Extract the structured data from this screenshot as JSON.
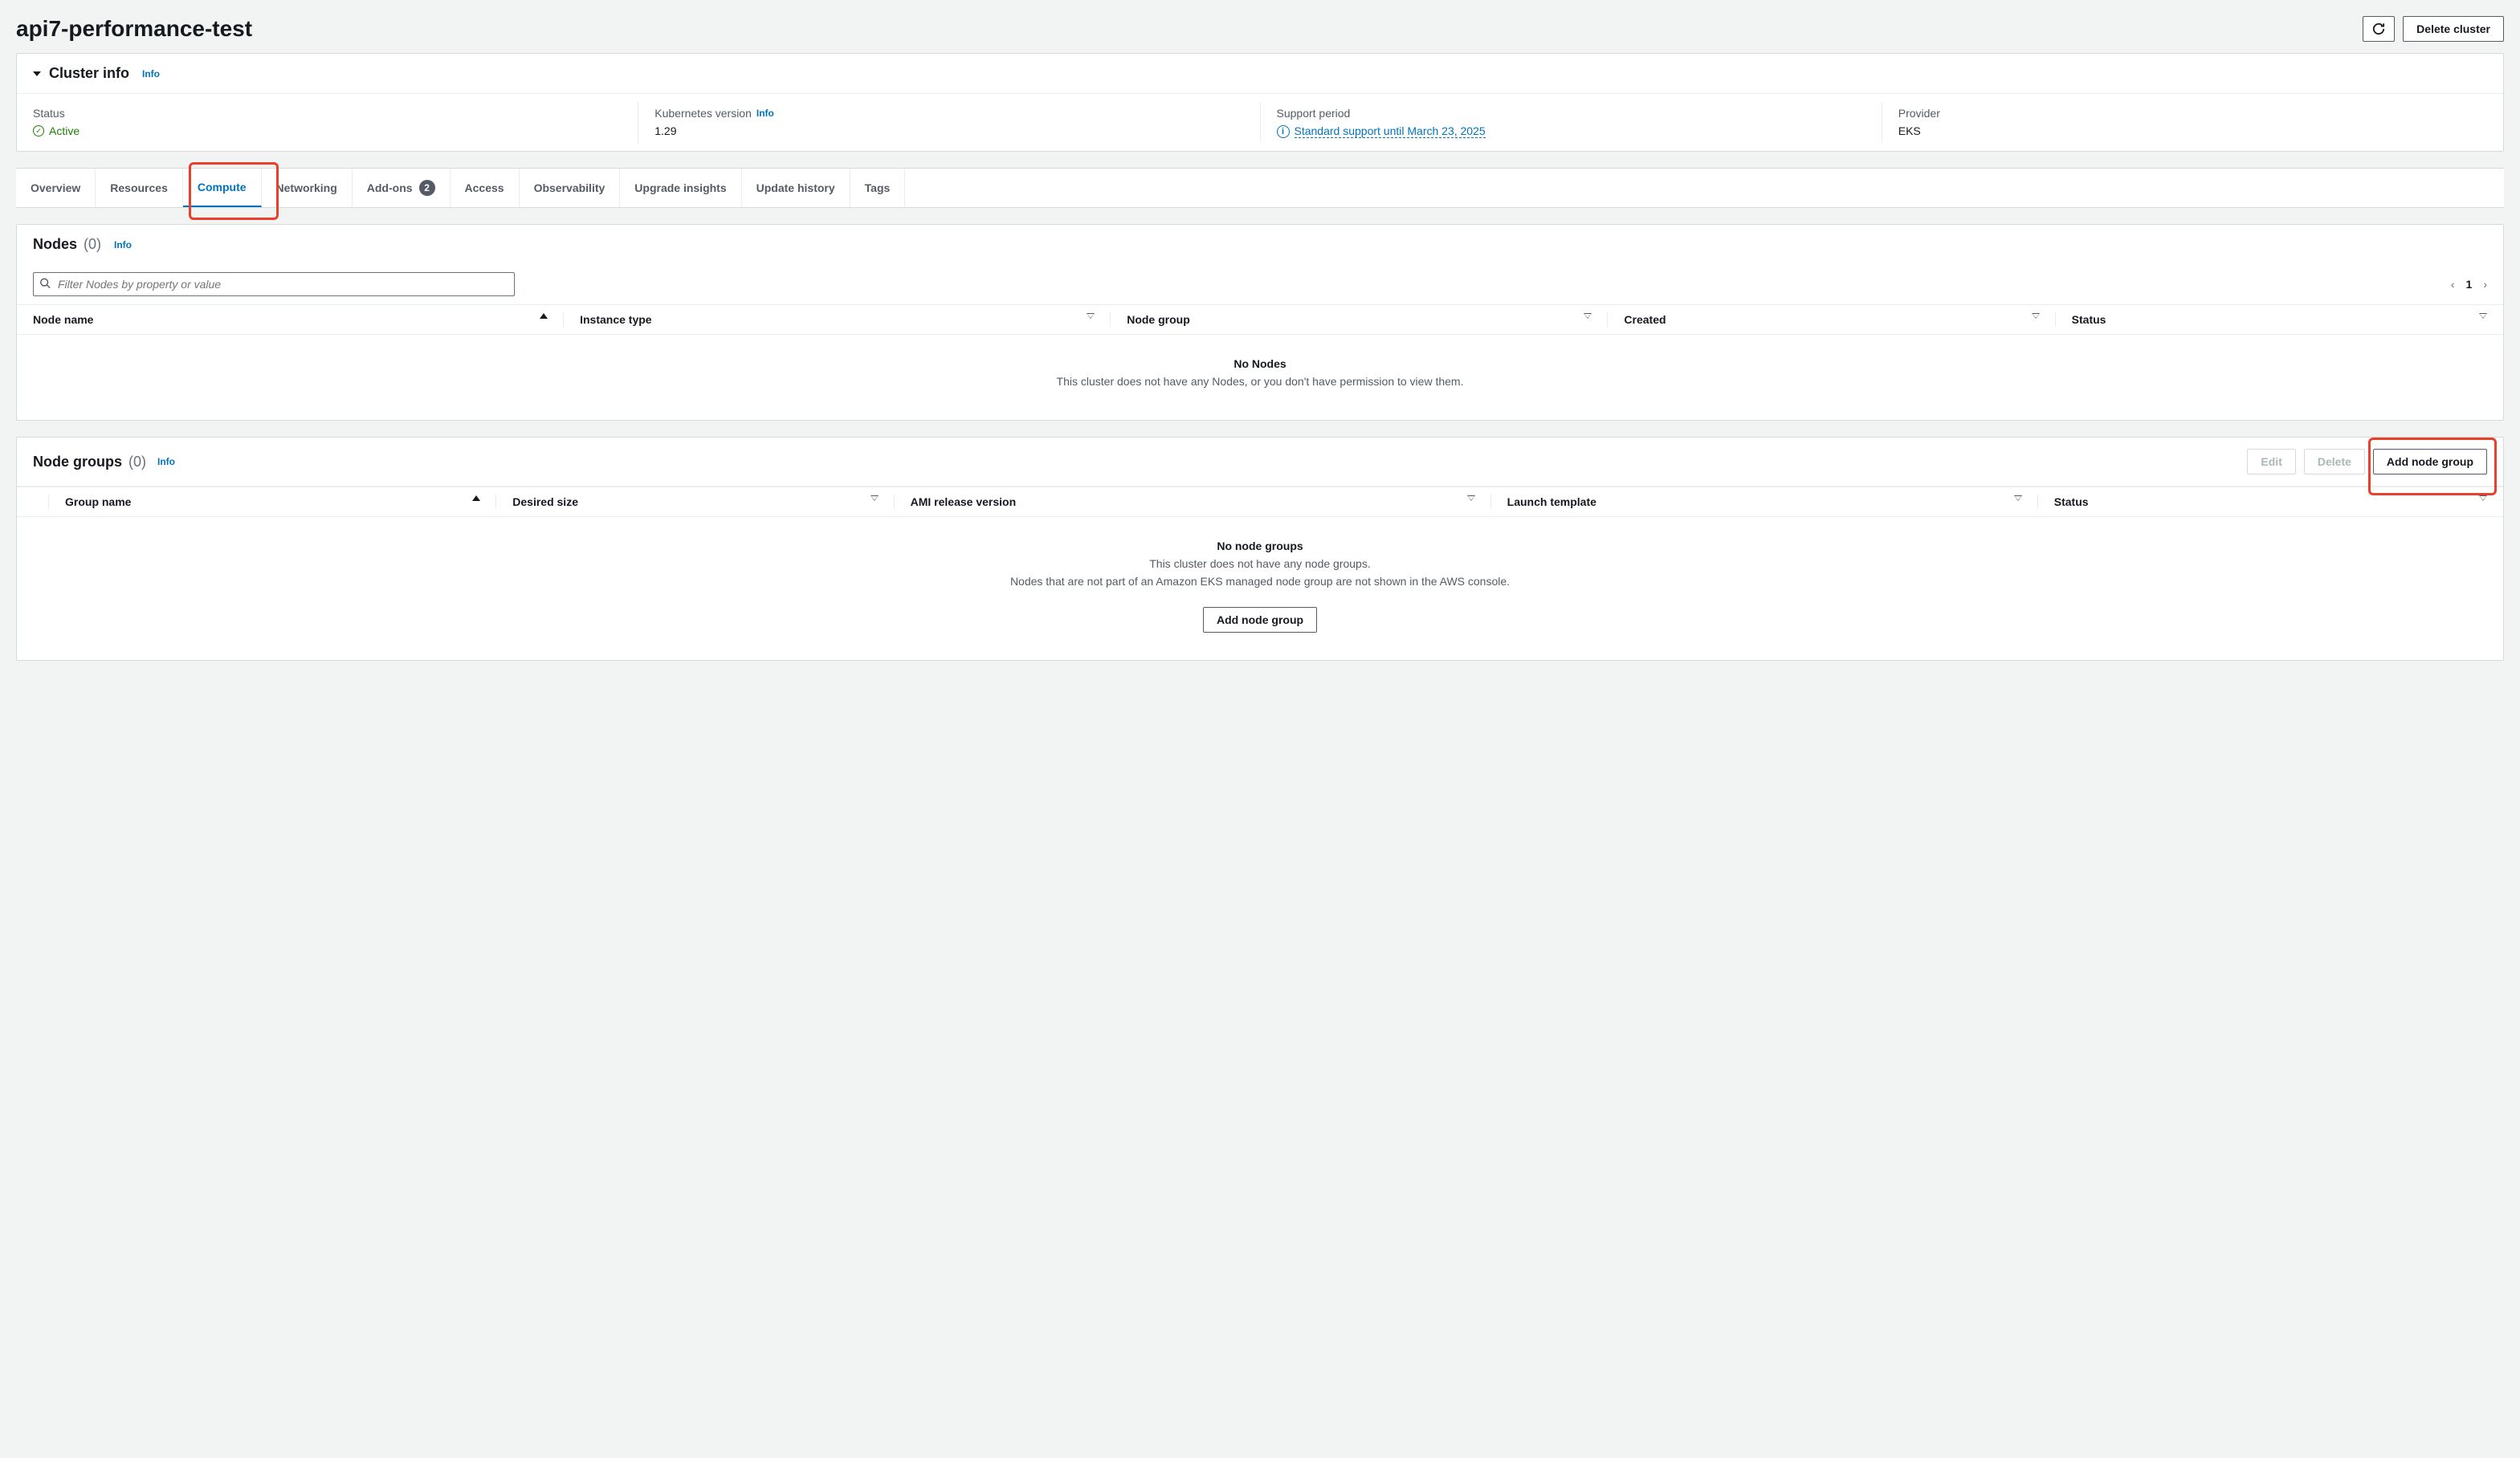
{
  "page": {
    "title": "api7-performance-test"
  },
  "header_actions": {
    "refresh_aria": "Refresh",
    "delete_cluster": "Delete cluster"
  },
  "cluster_info": {
    "heading": "Cluster info",
    "info_link": "Info",
    "status_label": "Status",
    "status_value": "Active",
    "k8s_label": "Kubernetes version",
    "k8s_info": "Info",
    "k8s_value": "1.29",
    "support_label": "Support period",
    "support_value": "Standard support until March 23, 2025",
    "provider_label": "Provider",
    "provider_value": "EKS"
  },
  "tabs": {
    "overview": "Overview",
    "resources": "Resources",
    "compute": "Compute",
    "networking": "Networking",
    "addons": "Add-ons",
    "addons_count": "2",
    "access": "Access",
    "observability": "Observability",
    "upgrade_insights": "Upgrade insights",
    "update_history": "Update history",
    "tags": "Tags"
  },
  "nodes": {
    "heading": "Nodes",
    "count": "(0)",
    "info": "Info",
    "filter_placeholder": "Filter Nodes by property or value",
    "page": "1",
    "cols": {
      "node_name": "Node name",
      "instance_type": "Instance type",
      "node_group": "Node group",
      "created": "Created",
      "status": "Status"
    },
    "empty_title": "No Nodes",
    "empty_sub": "This cluster does not have any Nodes, or you don't have permission to view them."
  },
  "node_groups": {
    "heading": "Node groups",
    "count": "(0)",
    "info": "Info",
    "edit": "Edit",
    "delete": "Delete",
    "add": "Add node group",
    "cols": {
      "group_name": "Group name",
      "desired_size": "Desired size",
      "ami": "AMI release version",
      "launch_template": "Launch template",
      "status": "Status"
    },
    "empty_title": "No node groups",
    "empty_sub1": "This cluster does not have any node groups.",
    "empty_sub2": "Nodes that are not part of an Amazon EKS managed node group are not shown in the AWS console.",
    "empty_action": "Add node group"
  }
}
